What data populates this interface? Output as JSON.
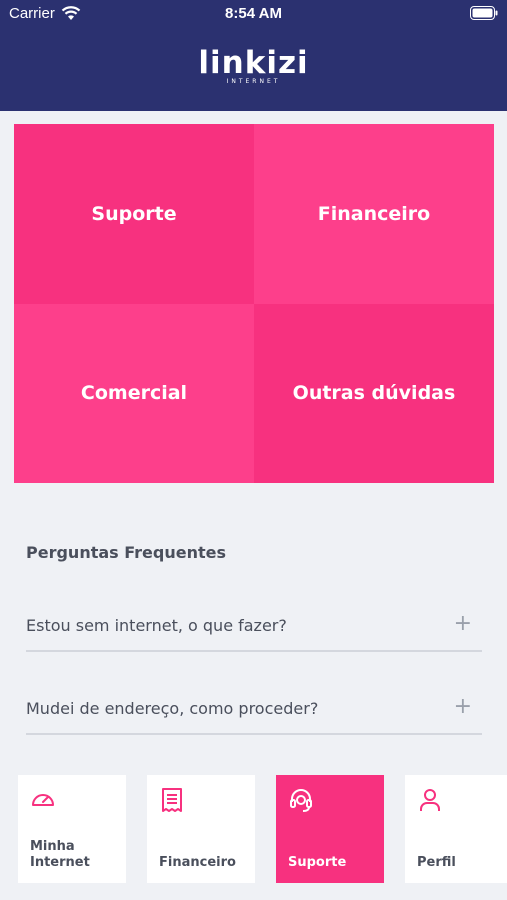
{
  "status_bar": {
    "carrier": "Carrier",
    "time": "8:54 AM"
  },
  "header": {
    "logo_text": "linkizi",
    "logo_subtext": "INTERNET"
  },
  "menu_tiles": [
    {
      "label": "Suporte"
    },
    {
      "label": "Financeiro"
    },
    {
      "label": "Comercial"
    },
    {
      "label": "Outras dúvidas"
    }
  ],
  "faq": {
    "title": "Perguntas Frequentes",
    "items": [
      {
        "question": "Estou sem internet, o que fazer?",
        "expand": "+"
      },
      {
        "question": "Mudei de endereço, como proceder?",
        "expand": "+"
      }
    ]
  },
  "bottom_nav": [
    {
      "label": "Minha\nInternet",
      "icon": "speedometer-icon",
      "active": false
    },
    {
      "label": "Financeiro",
      "icon": "receipt-icon",
      "active": false
    },
    {
      "label": "Suporte",
      "icon": "headset-icon",
      "active": true
    },
    {
      "label": "Perfil",
      "icon": "user-icon",
      "active": false
    }
  ],
  "colors": {
    "header_bg": "#2b3170",
    "brand_pink": "#f7317f",
    "brand_pink_light": "#fd3f8b",
    "page_bg": "#eff1f5"
  }
}
